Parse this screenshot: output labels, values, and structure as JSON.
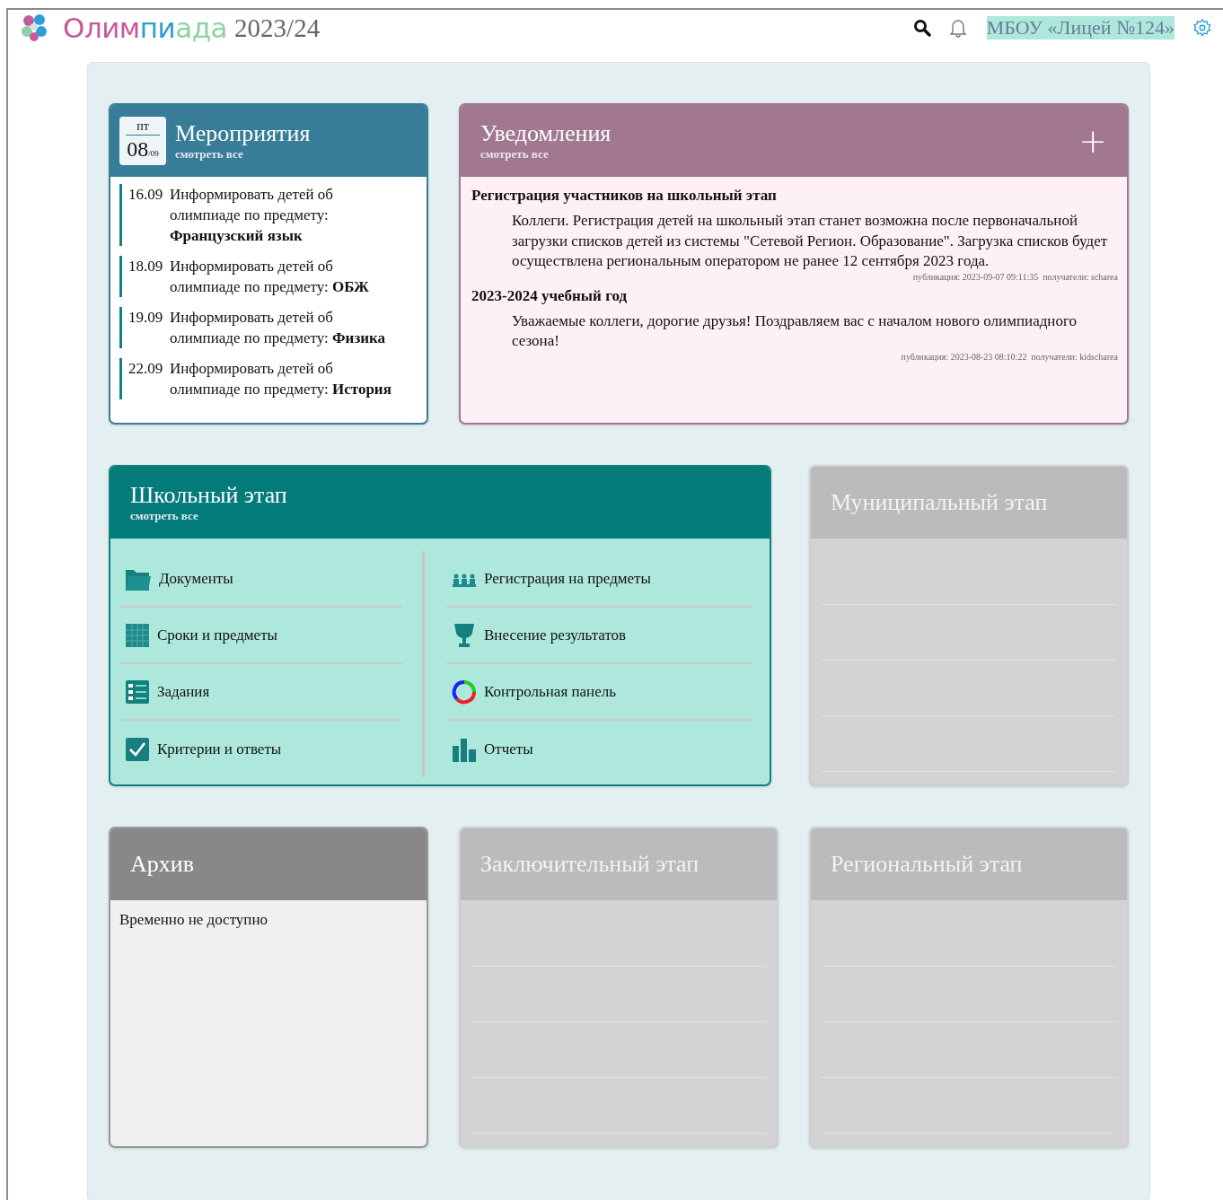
{
  "header": {
    "logo_parts": [
      {
        "text": "Олим",
        "color": "#c9589a"
      },
      {
        "text": "пи",
        "color": "#2a9fd6"
      },
      {
        "text": "ада",
        "color": "#8fd0a8"
      }
    ],
    "year": "2023/24",
    "school": "МБОУ «Лицей №124»"
  },
  "events": {
    "weekday": "пт",
    "day": "08",
    "month": "/09",
    "title": "Мероприятия",
    "link": "смотреть все",
    "items": [
      {
        "date": "16.09",
        "text": "Информировать детей об олимпиаде по предмету: **Французский язык**"
      },
      {
        "date": "18.09",
        "text": "Информировать детей об олимпиаде по предмету: **ОБЖ**"
      },
      {
        "date": "19.09",
        "text": "Информировать детей об олимпиаде по предмету: **Физика**"
      },
      {
        "date": "22.09",
        "text": "Информировать детей об олимпиаде по предмету: **История**"
      }
    ]
  },
  "notifications": {
    "title": "Уведомления",
    "link": "смотреть все",
    "add": "+",
    "items": [
      {
        "title": "Регистрация участников на школьный этап",
        "body": "Коллеги. Регистрация детей на школьный этап станет возможна после первоначальной загрузки списков детей из системы \"Сетевой Регион. Образование\". Загрузка списков будет осуществлена региональным оператором не ранее 12 сентября 2023 года.",
        "meta": "публикация: 2023-09-07 09:11:35  получатели: scharea"
      },
      {
        "title": "2023-2024 учебный год",
        "body": "Уважаемые коллеги, дорогие друзья! Поздравляем вас с началом нового олимпиадного сезона!",
        "meta": "публикация: 2023-08-23 08:10:22  получатели: kidscharea"
      }
    ]
  },
  "school_stage": {
    "title": "Школьный этап",
    "link": "смотреть все",
    "columns": [
      [
        "Документы",
        "Сроки и предметы",
        "Задания",
        "Критерии и ответы"
      ],
      [
        "Регистрация на предметы",
        "Внесение результатов",
        "Контрольная панель",
        "Отчеты"
      ]
    ]
  },
  "stages": [
    {
      "title": "Муниципальный этап",
      "kind": "inactive"
    },
    {
      "title": "Архив",
      "kind": "archived",
      "message": "Временно не доступно"
    },
    {
      "title": "Заключительный этап",
      "kind": "inactive"
    },
    {
      "title": "Региональный этап",
      "kind": "inactive"
    }
  ]
}
